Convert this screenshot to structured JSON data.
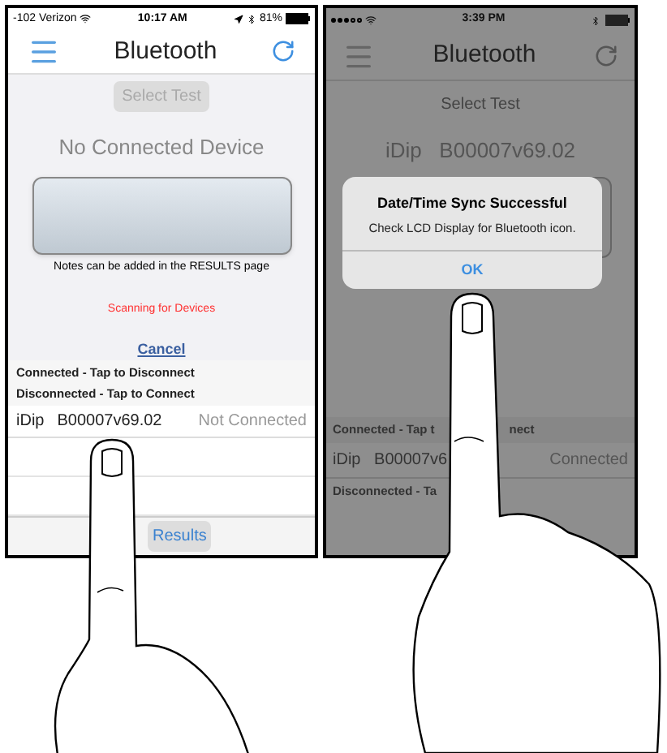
{
  "left_screen": {
    "status_bar": {
      "carrier": "-102 Verizon",
      "time": "10:17 AM",
      "battery": "81%"
    },
    "nav": {
      "title": "Bluetooth"
    },
    "select_test": {
      "label": "Select Test",
      "disabled": true
    },
    "heading": "No Connected Device",
    "notes": "Notes can be added in the RESULTS page",
    "scanning": "Scanning for Devices",
    "cancel": "Cancel",
    "connected_header": "Connected - Tap to Disconnect",
    "disconnected_header": "Disconnected - Tap to Connect",
    "devices": [
      {
        "name": "iDip",
        "serial": "B00007v69.02",
        "status": "Not Connected"
      }
    ],
    "results_button": "Results"
  },
  "right_screen": {
    "status_bar": {
      "time": "3:39 PM"
    },
    "nav": {
      "title": "Bluetooth"
    },
    "select_test": {
      "label": "Select Test",
      "disabled": false
    },
    "device_heading": "iDip   B00007v69.02",
    "alert": {
      "title": "Date/Time Sync Successful",
      "message": "Check LCD Display for Bluetooth icon.",
      "button": "OK"
    },
    "connected_header": [
      "Connected - Tap t",
      "nect"
    ],
    "device_row": {
      "name": "iDip   B00007v6",
      "status": "Connected"
    },
    "disconnected_header": "Disconnected - Ta"
  }
}
